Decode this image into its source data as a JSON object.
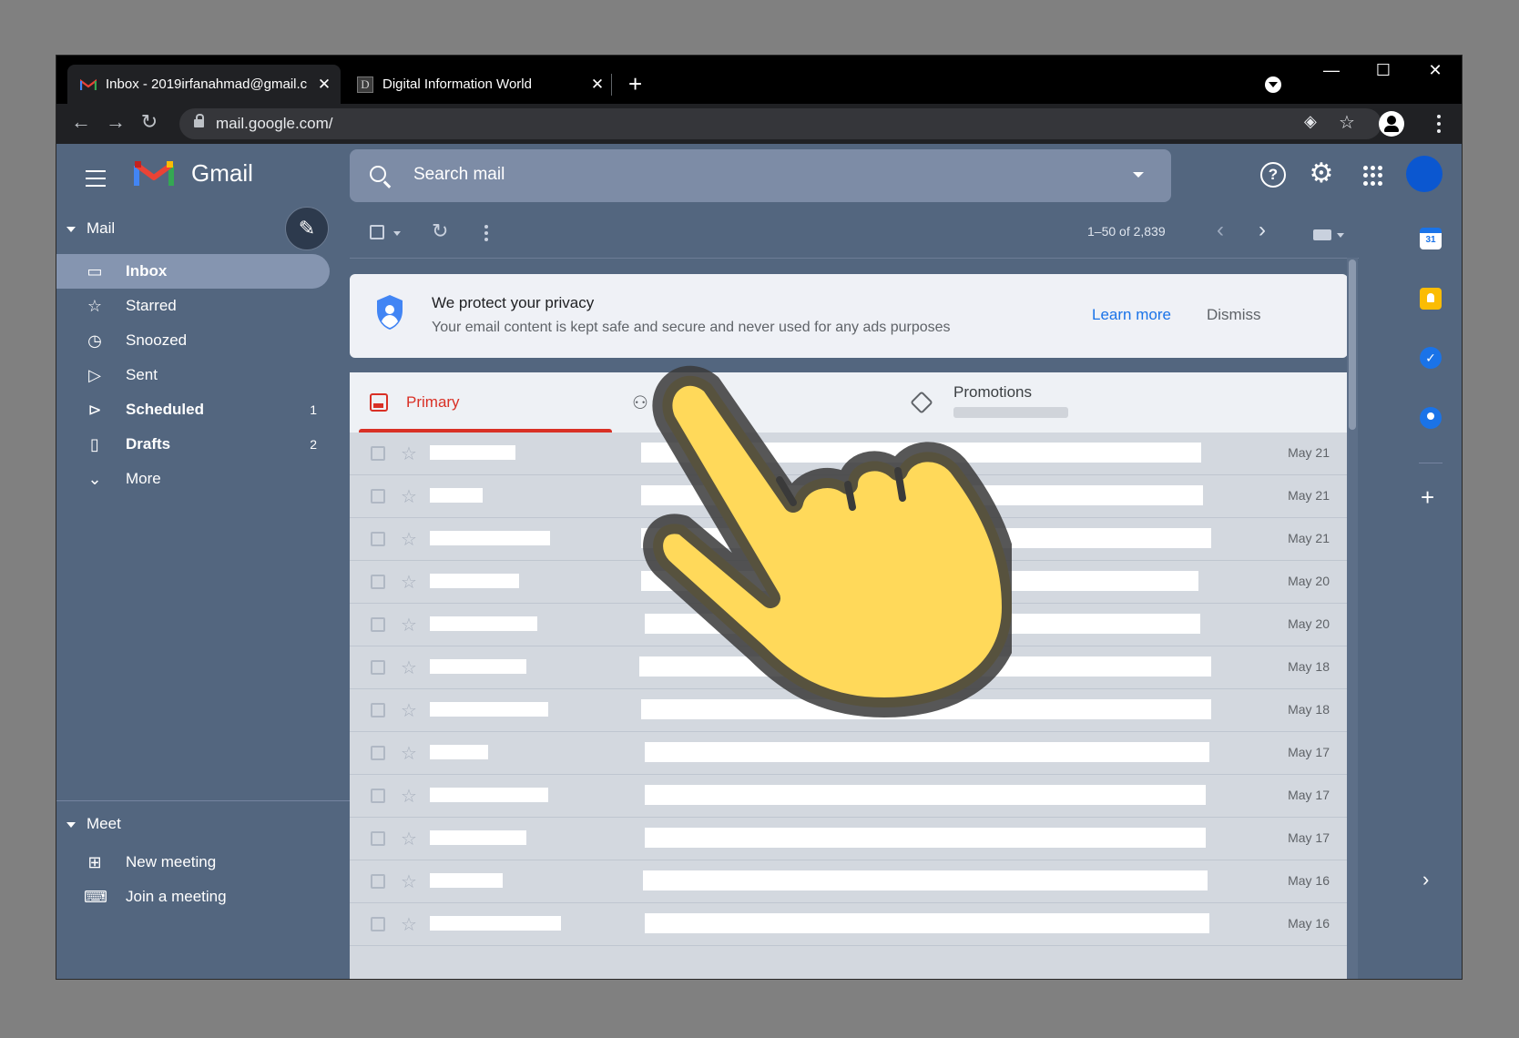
{
  "browser": {
    "tabs": [
      {
        "title": "Inbox - 2019irfanahmad@gmail.c",
        "favicon": "gmail-icon",
        "active": true
      },
      {
        "title": "Digital Information World",
        "favicon": "diw-icon",
        "active": false
      }
    ],
    "new_tab": "+",
    "url": "mail.google.com/",
    "window_controls": {
      "minimize": "—",
      "maximize": "☐",
      "close": "✕"
    }
  },
  "gmail": {
    "logo_text": "Gmail",
    "search_placeholder": "Search mail",
    "pager": "1–50 of 2,839"
  },
  "sidebar": {
    "mail_section": "Mail",
    "items": [
      {
        "label": "Inbox",
        "icon": "inbox-icon",
        "count": "",
        "active": true,
        "bold": true
      },
      {
        "label": "Starred",
        "icon": "star-icon",
        "count": "",
        "active": false,
        "bold": false
      },
      {
        "label": "Snoozed",
        "icon": "clock-icon",
        "count": "",
        "active": false,
        "bold": false
      },
      {
        "label": "Sent",
        "icon": "send-icon",
        "count": "",
        "active": false,
        "bold": false
      },
      {
        "label": "Scheduled",
        "icon": "scheduled-icon",
        "count": "1",
        "active": false,
        "bold": true
      },
      {
        "label": "Drafts",
        "icon": "draft-icon",
        "count": "2",
        "active": false,
        "bold": true
      },
      {
        "label": "More",
        "icon": "chevron-down-icon",
        "count": "",
        "active": false,
        "bold": false
      }
    ],
    "meet_section": "Meet",
    "meet_items": [
      {
        "label": "New meeting",
        "icon": "video-plus-icon"
      },
      {
        "label": "Join a meeting",
        "icon": "keyboard-icon"
      }
    ]
  },
  "privacy_banner": {
    "title": "We protect your privacy",
    "description": "Your email content is kept safe and secure and never used for any ads purposes",
    "learn_more": "Learn more",
    "dismiss": "Dismiss"
  },
  "inbox_tabs": {
    "primary": "Primary",
    "promotions": "Promotions"
  },
  "emails": [
    {
      "date": "May 21"
    },
    {
      "date": "May 21"
    },
    {
      "date": "May 21"
    },
    {
      "date": "May 20"
    },
    {
      "date": "May 20"
    },
    {
      "date": "May 18"
    },
    {
      "date": "May 18"
    },
    {
      "date": "May 17"
    },
    {
      "date": "May 17"
    },
    {
      "date": "May 17"
    },
    {
      "date": "May 16"
    },
    {
      "date": "May 16"
    }
  ],
  "side_panel": {
    "calendar_day": "31"
  },
  "colors": {
    "gmail_bg": "#53667f",
    "primary_red": "#d93025",
    "link_blue": "#1a73e8",
    "pointer_yellow": "#ffd95a"
  }
}
